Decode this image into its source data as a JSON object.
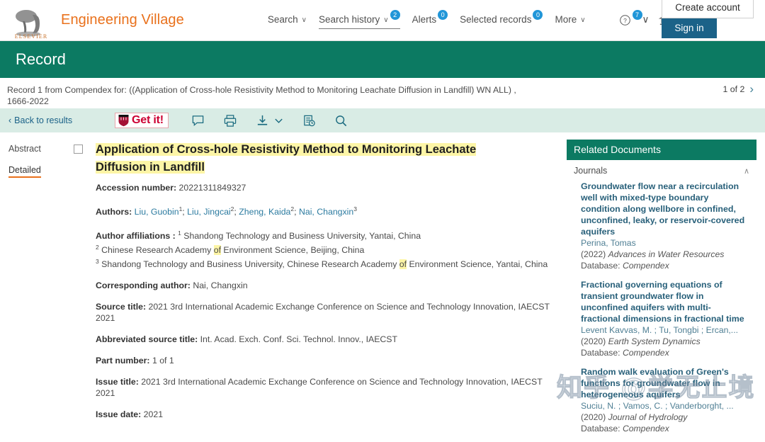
{
  "header": {
    "brand": "Engineering Village",
    "logo_text": "ELSEVIER",
    "nav": [
      {
        "label": "Search",
        "caret": "∨",
        "badge": null,
        "underlined": false
      },
      {
        "label": "Search history",
        "caret": "∨",
        "badge": "2",
        "underlined": true
      },
      {
        "label": "Alerts",
        "caret": null,
        "badge": "0",
        "underlined": false
      },
      {
        "label": "Selected records",
        "caret": null,
        "badge": "0",
        "underlined": false
      },
      {
        "label": "More",
        "caret": "∨",
        "badge": null,
        "underlined": false
      }
    ],
    "help_icon": "help-circle-icon",
    "help_badge": "7",
    "help_caret": "∨",
    "institution_icon": "institution-bank-icon",
    "institution_caret": "∨",
    "create_account": "Create account",
    "sign_in": "Sign in"
  },
  "banner": {
    "title": "Record"
  },
  "subhead": {
    "text": "Record 1 from Compendex for: ((Application of Cross-hole Resistivity Method to Monitoring Leachate Diffusion in Landfill) WN ALL) , 1666-2022",
    "pager_label": "1 of 2",
    "pager_next": "›"
  },
  "toolbar": {
    "back_label": "Back to results",
    "back_chevron": "‹",
    "getit_label": "Get it!",
    "icons": [
      "comment-icon",
      "print-icon",
      "download-icon",
      "chevron-down-icon",
      "document-history-icon",
      "search-icon"
    ]
  },
  "leftnav": {
    "items": [
      {
        "label": "Abstract",
        "active": false
      },
      {
        "label": "Detailed",
        "active": true
      }
    ]
  },
  "record": {
    "title_line1": "Application of Cross-hole Resistivity Method to Monitoring Leachate",
    "title_line2": "Diffusion in Landfill",
    "accession_label": "Accession number:",
    "accession_value": "20221311849327",
    "authors_label": "Authors:",
    "authors": [
      {
        "name": "Liu, Guobin",
        "sup": "1"
      },
      {
        "name": "Liu, Jingcai",
        "sup": "2"
      },
      {
        "name": "Zheng, Kaida",
        "sup": "2"
      },
      {
        "name": "Nai, Changxin",
        "sup": "3"
      }
    ],
    "affiliations_label": "Author affiliations :",
    "affiliations": [
      {
        "sup": "1",
        "pre": "Shandong Technology and Business University, Yantai, China",
        "hl": "",
        "post": ""
      },
      {
        "sup": "2",
        "pre": "Chinese Research Academy ",
        "hl": "of",
        "post": " Environment Science, Beijing, China"
      },
      {
        "sup": "3",
        "pre": "Shandong Technology and Business University, Chinese Research Academy ",
        "hl": "of",
        "post": " Environment Science, Yantai, China"
      }
    ],
    "corresponding_label": "Corresponding author:",
    "corresponding_value": "Nai, Changxin",
    "source_title_label": "Source title:",
    "source_title_value": "2021 3rd International Academic Exchange Conference on Science and Technology Innovation, IAECST 2021",
    "abbrev_label": "Abbreviated source title:",
    "abbrev_value": "Int. Acad. Exch. Conf. Sci. Technol. Innov., IAECST",
    "part_label": "Part number:",
    "part_value": "1 of 1",
    "issue_title_label": "Issue title:",
    "issue_title_value": "2021 3rd International Academic Exchange Conference on Science and Technology Innovation, IAECST 2021",
    "issue_date_label": "Issue date:",
    "issue_date_value": "2021"
  },
  "related": {
    "heading": "Related Documents",
    "group_label": "Journals",
    "collapse_icon": "∧",
    "items": [
      {
        "title": "Groundwater flow near a recirculation well with mixed-type boundary condition along wellbore in confined, unconfined, leaky, or reservoir-covered aquifers",
        "authors": "Perina, Tomas",
        "year": "(2022)",
        "source": "Advances in Water Resources",
        "database_label": "Database:",
        "database": "Compendex"
      },
      {
        "title": "Fractional governing equations of transient groundwater flow in unconfined aquifers with multi-fractional dimensions in fractional time",
        "authors": "Levent Kavvas, M. ; Tu, Tongbi ; Ercan,...",
        "year": "(2020)",
        "source": "Earth System Dynamics",
        "database_label": "Database:",
        "database": "Compendex"
      },
      {
        "title": "Random walk evaluation of Green's functions for groundwater flow in heterogeneous aquifers",
        "authors": "Suciu, N. ; Vamos, C. ; Vanderborght, ...",
        "year": "(2020)",
        "source": "Journal of Hydrology",
        "database_label": "Database:",
        "database": "Compendex"
      }
    ]
  },
  "watermark": {
    "text": "知乎 @学无止境"
  },
  "colors": {
    "brand_orange": "#e9711c",
    "teal": "#0c7a62",
    "toolbar_bg": "#d9ece5",
    "link_blue": "#2c7ba0",
    "signin_blue": "#1b6288",
    "badge_blue": "#2196d8",
    "highlight_yellow": "#fdf5a6",
    "getit_red": "#cc0033"
  }
}
